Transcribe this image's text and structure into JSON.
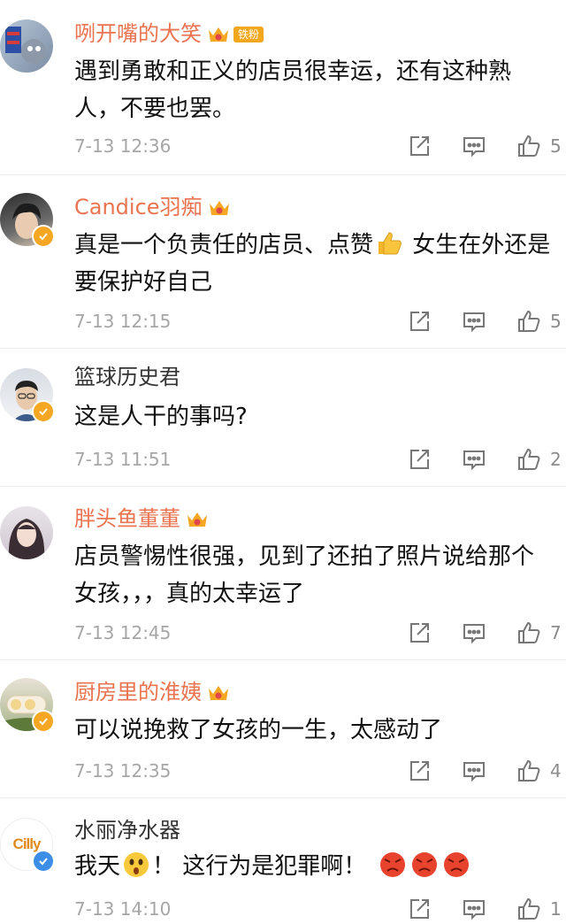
{
  "comments": [
    {
      "user": "咧开嘴的大笑",
      "vip": true,
      "fan_tag": "铁粉",
      "verified": false,
      "text": "遇到勇敢和正义的店员很幸运，还有这种熟人，不要也罢。",
      "time": "7-13 12:36",
      "likes": "5"
    },
    {
      "user": "Candice羽痴",
      "vip": true,
      "verified": true,
      "text_a": "真是一个负责任的店员、点赞",
      "text_b": " 女生在外还是要保护好自己",
      "emoji": "thumbs-up-emoji",
      "time": "7-13 12:15",
      "likes": "5"
    },
    {
      "user": "篮球历史君",
      "vip": false,
      "verified": true,
      "text": "这是人干的事吗?",
      "time": "7-13 11:51",
      "likes": "2"
    },
    {
      "user": "胖头鱼董董",
      "vip": true,
      "verified": false,
      "text": "店员警惕性很强，见到了还拍了照片说给那个女孩，，，真的太幸运了",
      "time": "7-13 12:45",
      "likes": "7"
    },
    {
      "user": "厨房里的淮姨",
      "vip": true,
      "verified": true,
      "text": "可以说挽救了女孩的一生，太感动了",
      "time": "7-13 12:35",
      "likes": "4"
    },
    {
      "user": "水丽净水器",
      "vip": false,
      "verified": true,
      "avatar_text": "Cilly",
      "text_a": "我天",
      "text_b": "！ 这行为是犯罪啊！",
      "emojis": [
        "surprised-emoji",
        "angry-emoji",
        "angry-emoji",
        "angry-emoji"
      ],
      "time": "7-13 14:10",
      "likes": "1"
    }
  ],
  "colors": {
    "vip_name": "#eb7350",
    "plain_name": "#333333",
    "time": "#a6a6a6",
    "accent": "#f5a623"
  },
  "icons": {
    "share": "share-icon",
    "reply": "comment-icon",
    "like": "thumbs-up-icon"
  }
}
